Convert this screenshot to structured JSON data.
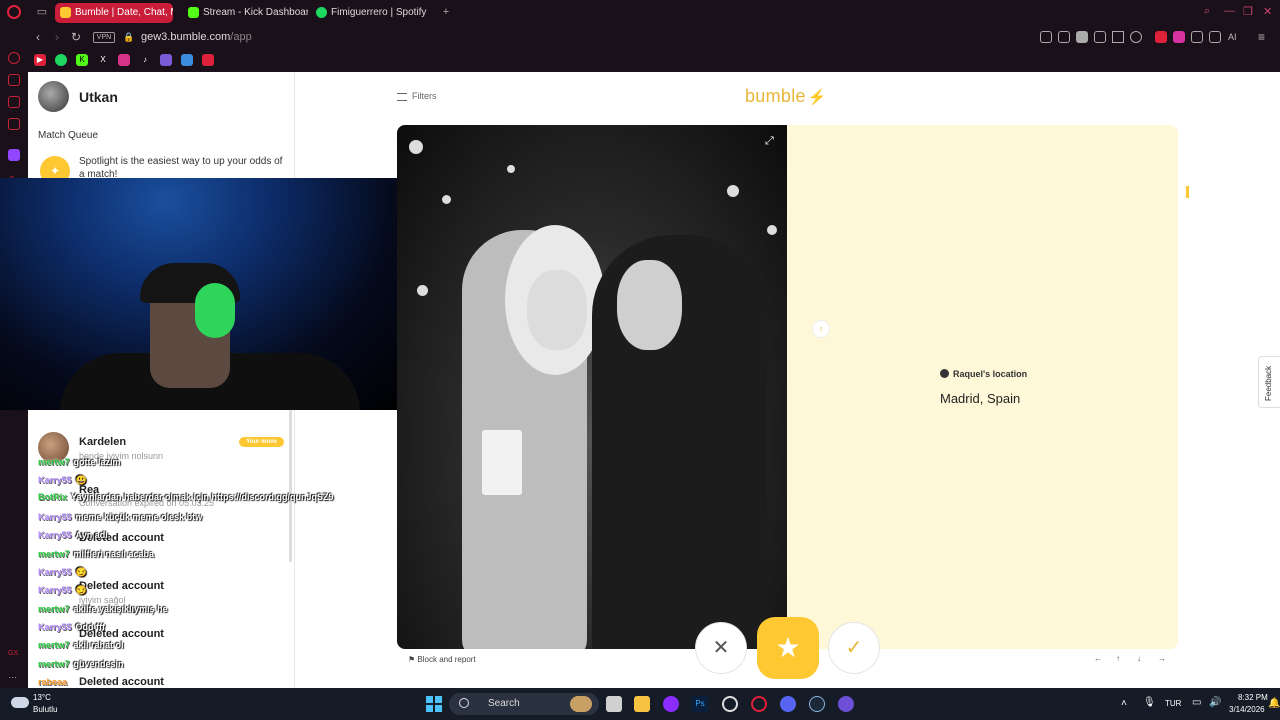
{
  "browser": {
    "tabs": [
      {
        "label": "Bumble | Date, Chat, Meet",
        "active": true,
        "favicon_color": "#fdc832"
      },
      {
        "label": "Stream - Kick Dashboard",
        "active": false,
        "favicon_color": "#53fc18"
      },
      {
        "label": "Fimiguerrero | Spotify",
        "active": false,
        "favicon_color": "#1ed760"
      }
    ],
    "new_tab_label": "+",
    "vpn_label": "VPN",
    "url_host": "gew3.bumble.com",
    "url_path": "/app",
    "ai_label": "AI"
  },
  "bumble": {
    "user_name": "Utkan",
    "match_queue_title": "Match Queue",
    "spotlight_text": "Spotlight is the easiest way to up your odds of a match!",
    "conversations": [
      {
        "name": "Kardelen",
        "preview": "bende iyiyim nolsunn",
        "badge": "Your move"
      },
      {
        "name": "Rea",
        "preview": "Conversation expired on 05.03.25"
      },
      {
        "name": "Deleted account",
        "preview": ""
      },
      {
        "name": "Deleted account",
        "preview": "iyiyim sağol"
      },
      {
        "name": "Deleted account",
        "preview": ""
      },
      {
        "name": "Deleted account",
        "preview": ""
      }
    ],
    "filters_label": "Filters",
    "logo_text": "bumble",
    "location_label": "Raquel's location",
    "location_value": "Madrid, Spain",
    "feedback_label": "Feedback",
    "block_report_label": "Block and report",
    "keyboard_hints": [
      "←",
      "↑",
      "↓",
      "→"
    ],
    "accent_color": "#fdc832"
  },
  "chat_overlay": [
    {
      "user": "mertw7",
      "color": "#27c93f",
      "message": "gotte lazım"
    },
    {
      "user": "Karry55",
      "color": "#b58cff",
      "message": "😃"
    },
    {
      "user": "BotRix",
      "color": "#27c93f",
      "message": "Yayınlardan haberdar olmak için https://discord.gg/qunJqSZ9"
    },
    {
      "user": "Karry55",
      "color": "#b58cff",
      "message": "meme küçük meme olesk btw"
    },
    {
      "user": "Karry55",
      "color": "#b58cff",
      "message": "Ayn adl"
    },
    {
      "user": "mertw7",
      "color": "#27c93f",
      "message": "milfleri nasıl acaba"
    },
    {
      "user": "Karry55",
      "color": "#b58cff",
      "message": "😏"
    },
    {
      "user": "Karry55",
      "color": "#b58cff",
      "message": "😏"
    },
    {
      "user": "mertw7",
      "color": "#27c93f",
      "message": "akilfe yakışıklıymış he"
    },
    {
      "user": "Karry55",
      "color": "#b58cff",
      "message": "Odd fff"
    },
    {
      "user": "mertw7",
      "color": "#27c93f",
      "message": "akil rahat ol"
    },
    {
      "user": "mertw7",
      "color": "#27c93f",
      "message": "güvendesin"
    },
    {
      "user": "rabeaa",
      "color": "#ff9c2a",
      "message": ""
    }
  ],
  "taskbar": {
    "weather_temp": "13°C",
    "weather_desc": "Bulutlu",
    "search_label": "Search",
    "language": "TUR",
    "time": "8:32 PM",
    "date": "3/14/2026"
  }
}
